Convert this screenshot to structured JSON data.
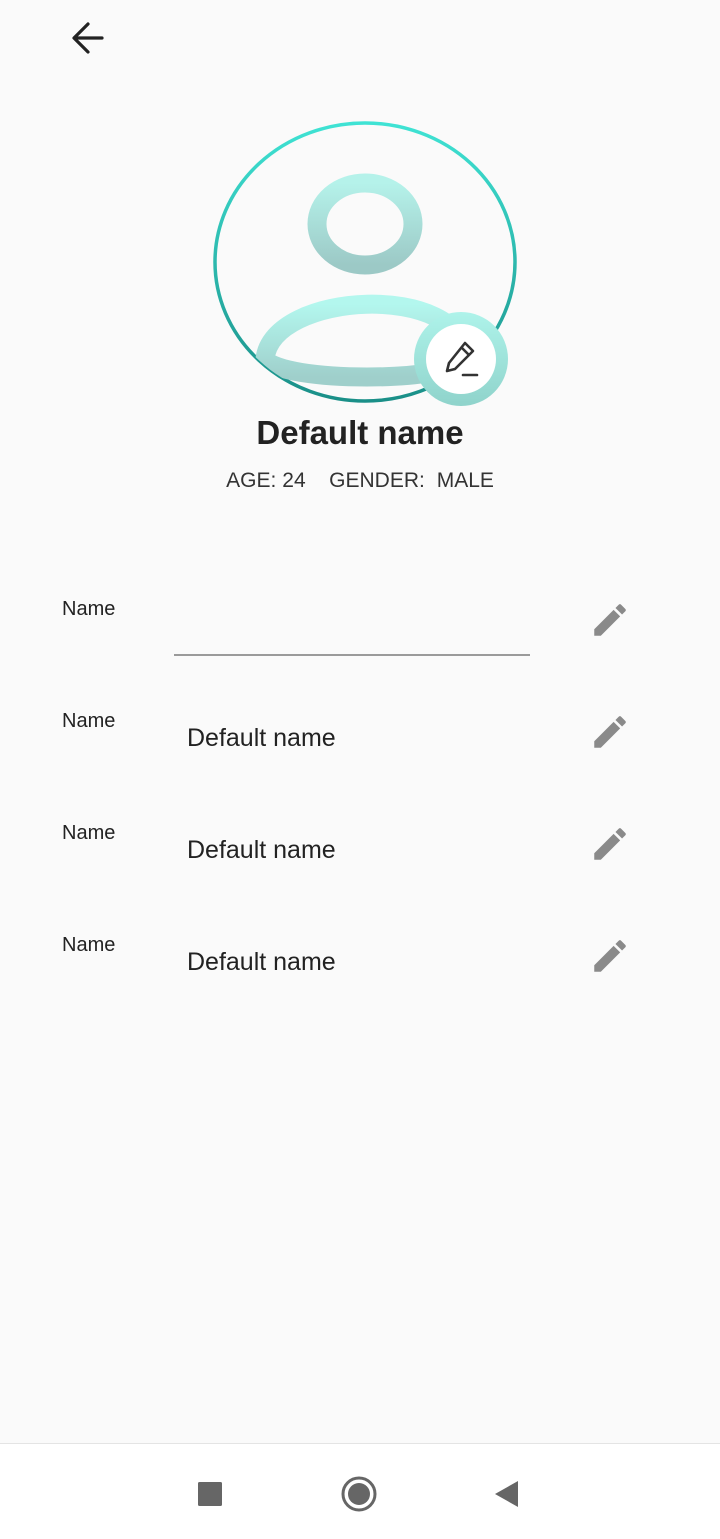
{
  "header": {
    "back_icon": "arrow-left-icon"
  },
  "profile": {
    "name": "Default name",
    "age_label": "AGE:",
    "age_value": "24",
    "gender_label": "GENDER:",
    "gender_value": "MALE",
    "avatar_icon": "person-avatar-icon",
    "edit_photo_icon": "pencil-edit-icon",
    "colors": {
      "accent_light": "#aef3ea",
      "accent_dark": "#14938a"
    }
  },
  "fields": [
    {
      "label": "Name",
      "value": "",
      "editing": true,
      "edit_icon": "pencil-icon"
    },
    {
      "label": "Name",
      "value": "Default name",
      "edit_icon": "pencil-icon"
    },
    {
      "label": "Name",
      "value": "Default name",
      "edit_icon": "pencil-icon"
    },
    {
      "label": "Name",
      "value": "Default name",
      "edit_icon": "pencil-icon"
    }
  ],
  "nav": {
    "recents_icon": "square-recents-icon",
    "home_icon": "circle-home-icon",
    "back_icon": "triangle-back-icon"
  }
}
